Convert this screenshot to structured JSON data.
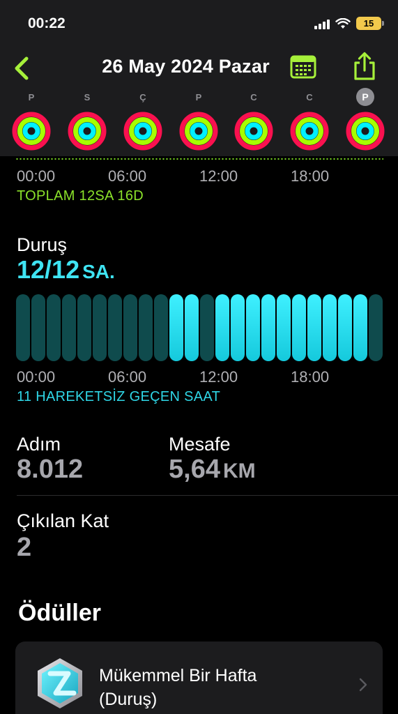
{
  "status_bar": {
    "time": "00:22",
    "battery": "15"
  },
  "nav": {
    "title": "26 May 2024 Pazar"
  },
  "week": {
    "days": [
      {
        "letter": "P",
        "selected": false
      },
      {
        "letter": "S",
        "selected": false
      },
      {
        "letter": "Ç",
        "selected": false
      },
      {
        "letter": "P",
        "selected": false
      },
      {
        "letter": "C",
        "selected": false
      },
      {
        "letter": "C",
        "selected": false
      },
      {
        "letter": "P",
        "selected": true
      }
    ]
  },
  "time_axis": [
    "00:00",
    "06:00",
    "12:00",
    "18:00"
  ],
  "exercise": {
    "total": "TOPLAM 12SA 16D"
  },
  "stand": {
    "label": "Duruş",
    "value": "12/12",
    "unit": "SA.",
    "hours_active": [
      0,
      0,
      0,
      0,
      0,
      0,
      0,
      0,
      0,
      0,
      1,
      1,
      0,
      1,
      1,
      1,
      1,
      1,
      1,
      1,
      1,
      1,
      1,
      0
    ],
    "inactive_caption": "11 HAREKETSİZ GEÇEN SAAT"
  },
  "steps": {
    "label": "Adım",
    "value": "8.012"
  },
  "distance": {
    "label": "Mesafe",
    "value": "5,64",
    "unit": "KM"
  },
  "floors": {
    "label": "Çıkılan Kat",
    "value": "2"
  },
  "awards": {
    "title": "Ödüller",
    "items": [
      {
        "title": "Mükemmel Bir Hafta (Duruş)"
      }
    ]
  },
  "colors": {
    "move": "#fa114f",
    "exercise": "#a6ff00",
    "stand": "#00f0ff",
    "accent_green": "#77d421",
    "stand_text": "#3fe4f3"
  }
}
